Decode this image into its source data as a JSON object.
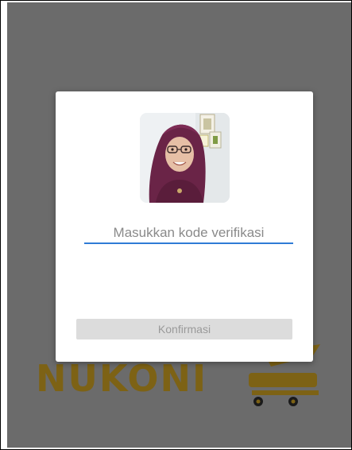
{
  "background": {
    "brand_logo_text": "NUKONI",
    "overlay_color": "#6b6b6b",
    "logo_color": "#7d6215"
  },
  "dialog": {
    "captcha_image": "captcha-photo",
    "code_input": {
      "placeholder": "Masukkan kode verifikasi",
      "value": ""
    },
    "confirm_label": "Konfirmasi",
    "accent_color": "#2f7bd6"
  }
}
